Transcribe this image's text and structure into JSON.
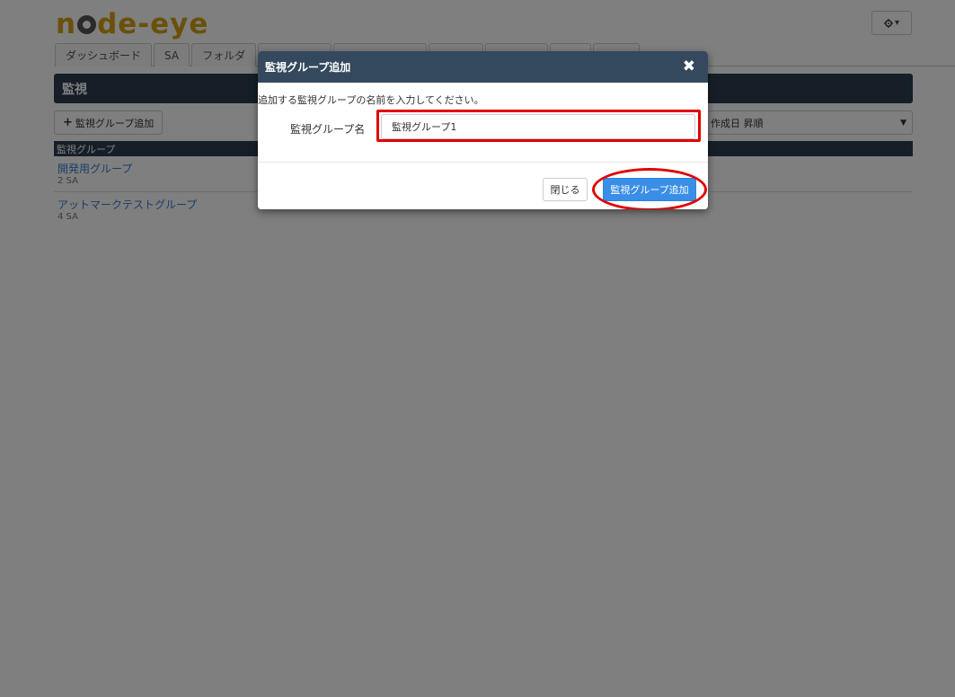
{
  "app": {
    "logo_text_before": "n",
    "logo_text_after": "de-eye"
  },
  "header": {
    "settings_caret": "▾"
  },
  "nav": {
    "tabs": [
      {
        "label": "ダッシュボード"
      },
      {
        "label": "SA"
      },
      {
        "label": "フォルダ"
      },
      {
        "label": ""
      },
      {
        "label": ""
      },
      {
        "label": ""
      },
      {
        "label": ""
      },
      {
        "label": ""
      },
      {
        "label": ""
      }
    ]
  },
  "main": {
    "section_title": "監視",
    "add_button_label": "監視グループ追加",
    "sort_selected": "作成日 昇順",
    "list_header": "監視グループ",
    "groups": [
      {
        "name": "開発用グループ",
        "count": "2 SA"
      },
      {
        "name": "アットマークテストグループ",
        "count": "4 SA"
      }
    ]
  },
  "modal": {
    "title": "監視グループ追加",
    "instruction": "追加する監視グループの名前を入力してください。",
    "field_label": "監視グループ名",
    "field_value": "監視グループ1",
    "close_button": "閉じる",
    "submit_button": "監視グループ追加"
  },
  "colors": {
    "logo": "#d4a017",
    "header_bar": "#2c3e50",
    "modal_header": "#34495e",
    "primary_button": "#3a8ee6",
    "highlight": "#e00000",
    "link": "#3a7bd5"
  }
}
